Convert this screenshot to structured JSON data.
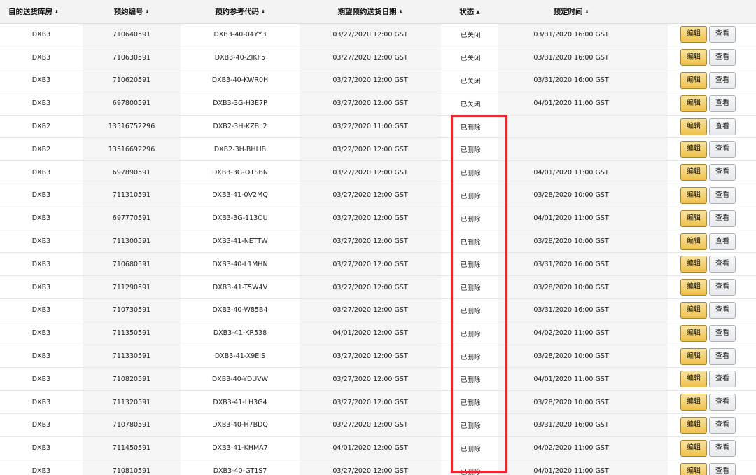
{
  "table": {
    "headers": {
      "dest": "目的送货库房",
      "appt": "预约编号",
      "ref": "预约参考代码",
      "date": "期望预约送货日期",
      "status": "状态",
      "sched": "预定时间"
    },
    "sort_icons": {
      "dest": "⬍",
      "appt": "⬍",
      "ref": "⬍",
      "date": "⬍",
      "status": "▲",
      "sched": "⬍"
    },
    "buttons": {
      "edit": "编辑",
      "view": "查看"
    },
    "rows": [
      {
        "dest": "DXB3",
        "appt": "710640591",
        "ref": "DXB3-40-04YY3",
        "date": "03/27/2020 12:00 GST",
        "status": "已关闭",
        "sched": "03/31/2020 16:00 GST"
      },
      {
        "dest": "DXB3",
        "appt": "710630591",
        "ref": "DXB3-40-ZIKF5",
        "date": "03/27/2020 12:00 GST",
        "status": "已关闭",
        "sched": "03/31/2020 16:00 GST"
      },
      {
        "dest": "DXB3",
        "appt": "710620591",
        "ref": "DXB3-40-KWR0H",
        "date": "03/27/2020 12:00 GST",
        "status": "已关闭",
        "sched": "03/31/2020 16:00 GST"
      },
      {
        "dest": "DXB3",
        "appt": "697800591",
        "ref": "DXB3-3G-H3E7P",
        "date": "03/27/2020 12:00 GST",
        "status": "已关闭",
        "sched": "04/01/2020 11:00 GST"
      },
      {
        "dest": "DXB2",
        "appt": "13516752296",
        "ref": "DXB2-3H-KZBL2",
        "date": "03/22/2020 11:00 GST",
        "status": "已删除",
        "sched": ""
      },
      {
        "dest": "DXB2",
        "appt": "13516692296",
        "ref": "DXB2-3H-BHLIB",
        "date": "03/22/2020 12:00 GST",
        "status": "已删除",
        "sched": ""
      },
      {
        "dest": "DXB3",
        "appt": "697890591",
        "ref": "DXB3-3G-O1SBN",
        "date": "03/27/2020 12:00 GST",
        "status": "已删除",
        "sched": "04/01/2020 11:00 GST"
      },
      {
        "dest": "DXB3",
        "appt": "711310591",
        "ref": "DXB3-41-0V2MQ",
        "date": "03/27/2020 12:00 GST",
        "status": "已删除",
        "sched": "03/28/2020 10:00 GST"
      },
      {
        "dest": "DXB3",
        "appt": "697770591",
        "ref": "DXB3-3G-113OU",
        "date": "03/27/2020 12:00 GST",
        "status": "已删除",
        "sched": "04/01/2020 11:00 GST"
      },
      {
        "dest": "DXB3",
        "appt": "711300591",
        "ref": "DXB3-41-NETTW",
        "date": "03/27/2020 12:00 GST",
        "status": "已删除",
        "sched": "03/28/2020 10:00 GST"
      },
      {
        "dest": "DXB3",
        "appt": "710680591",
        "ref": "DXB3-40-L1MHN",
        "date": "03/27/2020 12:00 GST",
        "status": "已删除",
        "sched": "03/31/2020 16:00 GST"
      },
      {
        "dest": "DXB3",
        "appt": "711290591",
        "ref": "DXB3-41-T5W4V",
        "date": "03/27/2020 12:00 GST",
        "status": "已删除",
        "sched": "03/28/2020 10:00 GST"
      },
      {
        "dest": "DXB3",
        "appt": "710730591",
        "ref": "DXB3-40-W85B4",
        "date": "03/27/2020 12:00 GST",
        "status": "已删除",
        "sched": "03/31/2020 16:00 GST"
      },
      {
        "dest": "DXB3",
        "appt": "711350591",
        "ref": "DXB3-41-KR538",
        "date": "04/01/2020 12:00 GST",
        "status": "已删除",
        "sched": "04/02/2020 11:00 GST"
      },
      {
        "dest": "DXB3",
        "appt": "711330591",
        "ref": "DXB3-41-X9EIS",
        "date": "03/27/2020 12:00 GST",
        "status": "已删除",
        "sched": "03/28/2020 10:00 GST"
      },
      {
        "dest": "DXB3",
        "appt": "710820591",
        "ref": "DXB3-40-YDUVW",
        "date": "03/27/2020 12:00 GST",
        "status": "已删除",
        "sched": "04/01/2020 11:00 GST"
      },
      {
        "dest": "DXB3",
        "appt": "711320591",
        "ref": "DXB3-41-LH3G4",
        "date": "03/27/2020 12:00 GST",
        "status": "已删除",
        "sched": "03/28/2020 10:00 GST"
      },
      {
        "dest": "DXB3",
        "appt": "710780591",
        "ref": "DXB3-40-H7BDQ",
        "date": "03/27/2020 12:00 GST",
        "status": "已删除",
        "sched": "03/31/2020 16:00 GST"
      },
      {
        "dest": "DXB3",
        "appt": "711450591",
        "ref": "DXB3-41-KHMA7",
        "date": "04/01/2020 12:00 GST",
        "status": "已删除",
        "sched": "04/02/2020 11:00 GST"
      },
      {
        "dest": "DXB3",
        "appt": "710810591",
        "ref": "DXB3-40-GT1S7",
        "date": "03/27/2020 12:00 GST",
        "status": "已删除",
        "sched": "04/01/2020 11:00 GST"
      }
    ]
  },
  "annotation": {
    "highlight_color": "#e8272e"
  }
}
